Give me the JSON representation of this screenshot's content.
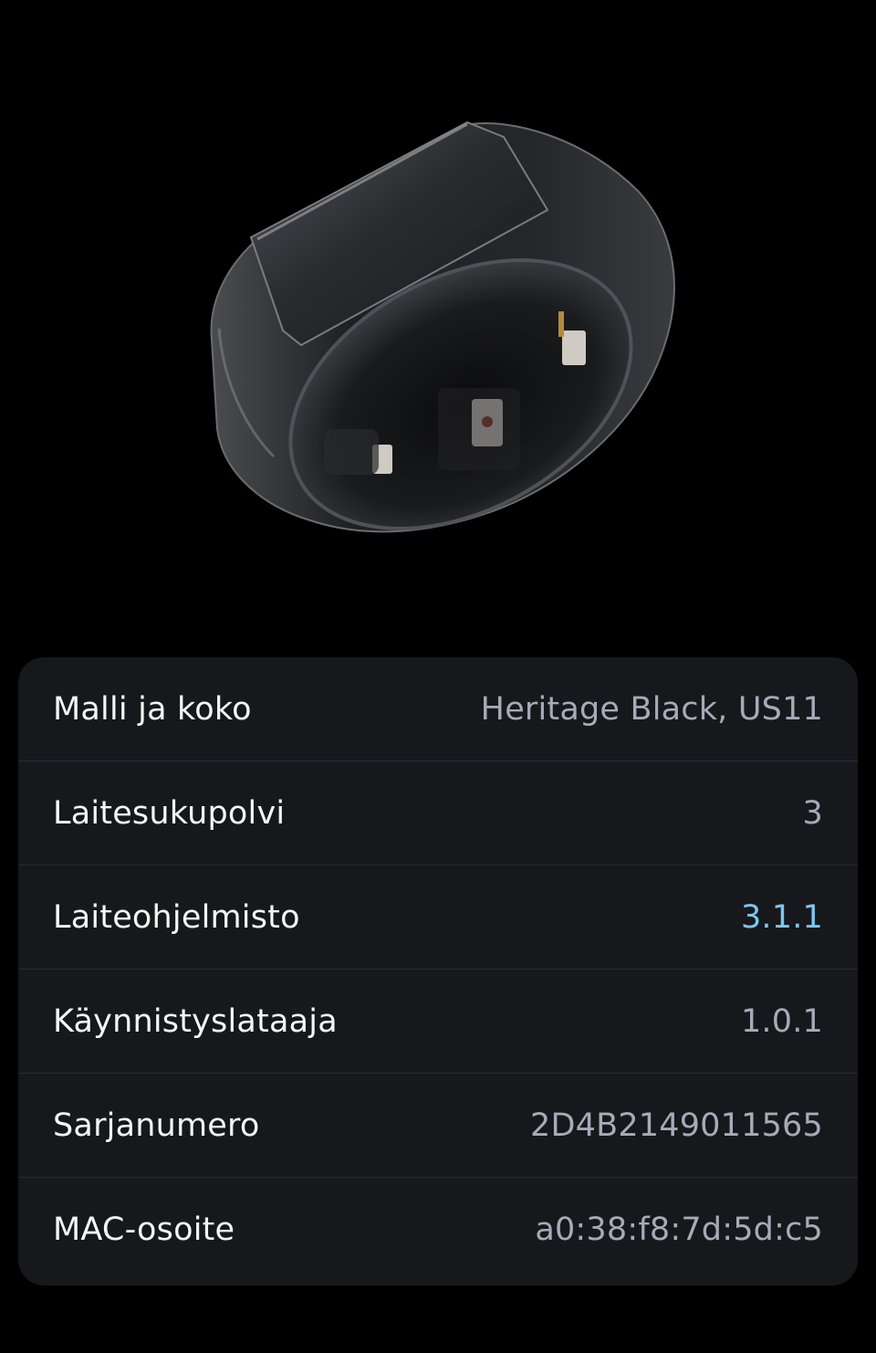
{
  "device_image": {
    "alt_icon": "oura-ring-image",
    "ring_color": "#2b2c30"
  },
  "details": {
    "rows": [
      {
        "label": "Malli ja koko",
        "value": "Heritage Black, US11"
      },
      {
        "label": "Laitesukupolvi",
        "value": "3"
      },
      {
        "label": "Laiteohjelmisto",
        "value": "3.1.1"
      },
      {
        "label": "Käynnistyslataaja",
        "value": "1.0.1"
      },
      {
        "label": "Sarjanumero",
        "value": "2D4B2149011565"
      },
      {
        "label": "MAC-osoite",
        "value": "a0:38:f8:7d:5d:c5"
      }
    ]
  },
  "colors": {
    "background": "#000000",
    "card": "#17181c",
    "divider": "#2a2c31",
    "label_text": "#f5f5f7",
    "value_text": "#a6abb8",
    "link_value": "#7ec6f2"
  }
}
